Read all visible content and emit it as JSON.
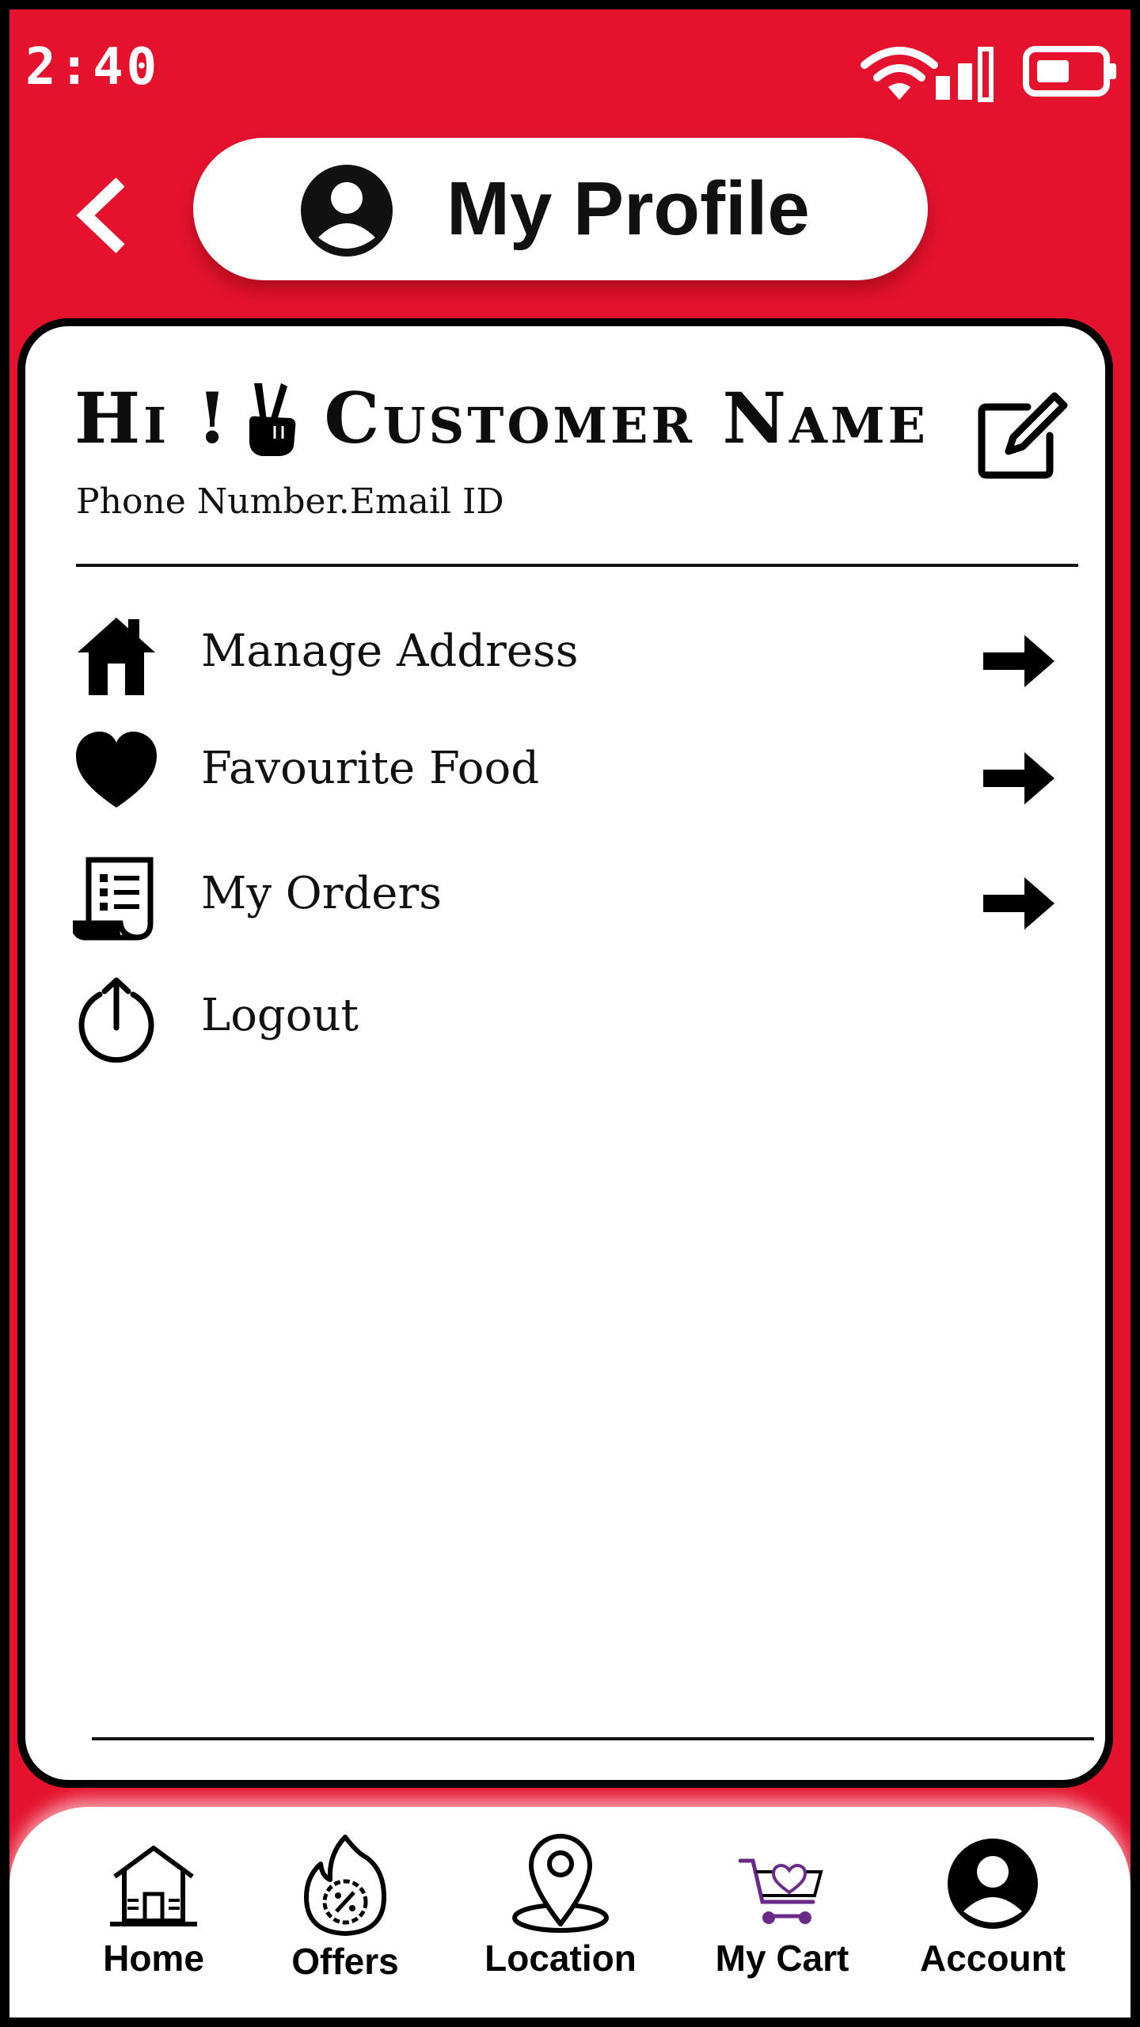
{
  "status_bar": {
    "time": "2:40",
    "icons": [
      "wifi-icon",
      "signal-icon",
      "battery-icon"
    ]
  },
  "header": {
    "back_icon": "chevron-left-icon",
    "title": "My Profile",
    "title_icon": "user-circle-icon"
  },
  "profile": {
    "greeting_prefix": "Hi !",
    "greeting_icon": "victory-hand-icon",
    "customer_name": "Customer Name",
    "contact": "Phone Number.Email ID",
    "edit_icon": "edit-icon"
  },
  "menu": [
    {
      "label": "Manage Address",
      "icon": "home-icon",
      "arrow": true
    },
    {
      "label": "Favourite Food",
      "icon": "heart-icon",
      "arrow": true
    },
    {
      "label": "My Orders",
      "icon": "receipt-icon",
      "arrow": true
    },
    {
      "label": "Logout",
      "icon": "logout-icon",
      "arrow": false
    }
  ],
  "bottom_nav": [
    {
      "label": "Home",
      "icon": "home-outline-icon"
    },
    {
      "label": "Offers",
      "icon": "offers-icon"
    },
    {
      "label": "Location",
      "icon": "location-pin-icon"
    },
    {
      "label": "My Cart",
      "icon": "cart-icon"
    },
    {
      "label": "Account",
      "icon": "account-icon"
    }
  ],
  "colors": {
    "brand_red": "#e5122d",
    "text": "#111111",
    "cart_accent": "#6b2a8a"
  }
}
